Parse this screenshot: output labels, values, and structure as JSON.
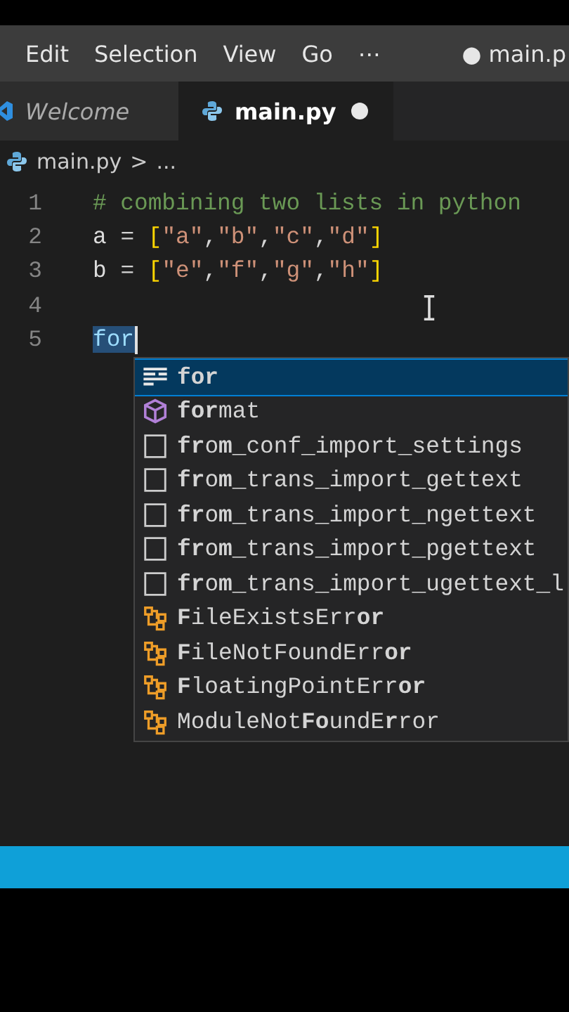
{
  "menu_bar": {
    "items": [
      "Edit",
      "Selection",
      "View",
      "Go",
      "⋯"
    ],
    "title": "● main.p"
  },
  "tabs": [
    {
      "label": "Welcome",
      "kind": "welcome",
      "selected": false,
      "modified": false
    },
    {
      "label": "main.py",
      "kind": "python",
      "selected": true,
      "modified": true
    }
  ],
  "breadcrumb": {
    "file": "main.py",
    "separator": ">",
    "rest": "..."
  },
  "editor": {
    "lines": [
      {
        "number": "1",
        "tokens": [
          {
            "text": "# combining two lists in python",
            "kind": "comment"
          }
        ]
      },
      {
        "number": "2",
        "tokens": [
          {
            "text": "a ",
            "kind": "ident"
          },
          {
            "text": "= ",
            "kind": "op"
          },
          {
            "text": "[",
            "kind": "bracket"
          },
          {
            "text": "\"a\"",
            "kind": "string"
          },
          {
            "text": ",",
            "kind": "op"
          },
          {
            "text": "\"b\"",
            "kind": "string"
          },
          {
            "text": ",",
            "kind": "op"
          },
          {
            "text": "\"c\"",
            "kind": "string"
          },
          {
            "text": ",",
            "kind": "op"
          },
          {
            "text": "\"d\"",
            "kind": "string"
          },
          {
            "text": "]",
            "kind": "bracket"
          }
        ]
      },
      {
        "number": "3",
        "tokens": [
          {
            "text": "b ",
            "kind": "ident"
          },
          {
            "text": "= ",
            "kind": "op"
          },
          {
            "text": "[",
            "kind": "bracket"
          },
          {
            "text": "\"e\"",
            "kind": "string"
          },
          {
            "text": ",",
            "kind": "op"
          },
          {
            "text": "\"f\"",
            "kind": "string"
          },
          {
            "text": ",",
            "kind": "op"
          },
          {
            "text": "\"g\"",
            "kind": "string"
          },
          {
            "text": ",",
            "kind": "op"
          },
          {
            "text": "\"h\"",
            "kind": "string"
          },
          {
            "text": "]",
            "kind": "bracket"
          }
        ]
      },
      {
        "number": "4"
      },
      {
        "number": "5",
        "tokens": [
          {
            "text": "for",
            "kind": "typed"
          }
        ],
        "cursor": true
      }
    ]
  },
  "suggestions": [
    {
      "label": "**for**",
      "kind": "keyword",
      "selected": true
    },
    {
      "label": "**for**mat",
      "kind": "method",
      "selected": false
    },
    {
      "label": "**fr**o**m**_conf_import_settings",
      "kind": "snippet",
      "selected": false
    },
    {
      "label": "**fr**o**m**_trans_import_gettext",
      "kind": "snippet",
      "selected": false
    },
    {
      "label": "**fr**o**m**_trans_import_ngettext",
      "kind": "snippet",
      "selected": false
    },
    {
      "label": "**fr**o**m**_trans_import_pgettext",
      "kind": "snippet",
      "selected": false
    },
    {
      "label": "**fr**o**m**_trans_import_ugettext_l",
      "kind": "snippet",
      "selected": false
    },
    {
      "label": "**F**ileExistsErr**or**",
      "kind": "class",
      "selected": false
    },
    {
      "label": "**F**ileNotFoundErr**or**",
      "kind": "class",
      "selected": false
    },
    {
      "label": "**F**loatingPointErr**or**",
      "kind": "class",
      "selected": false
    },
    {
      "label": "ModuleNot**Fo**undE**r**ror",
      "kind": "class",
      "selected": false
    }
  ]
}
